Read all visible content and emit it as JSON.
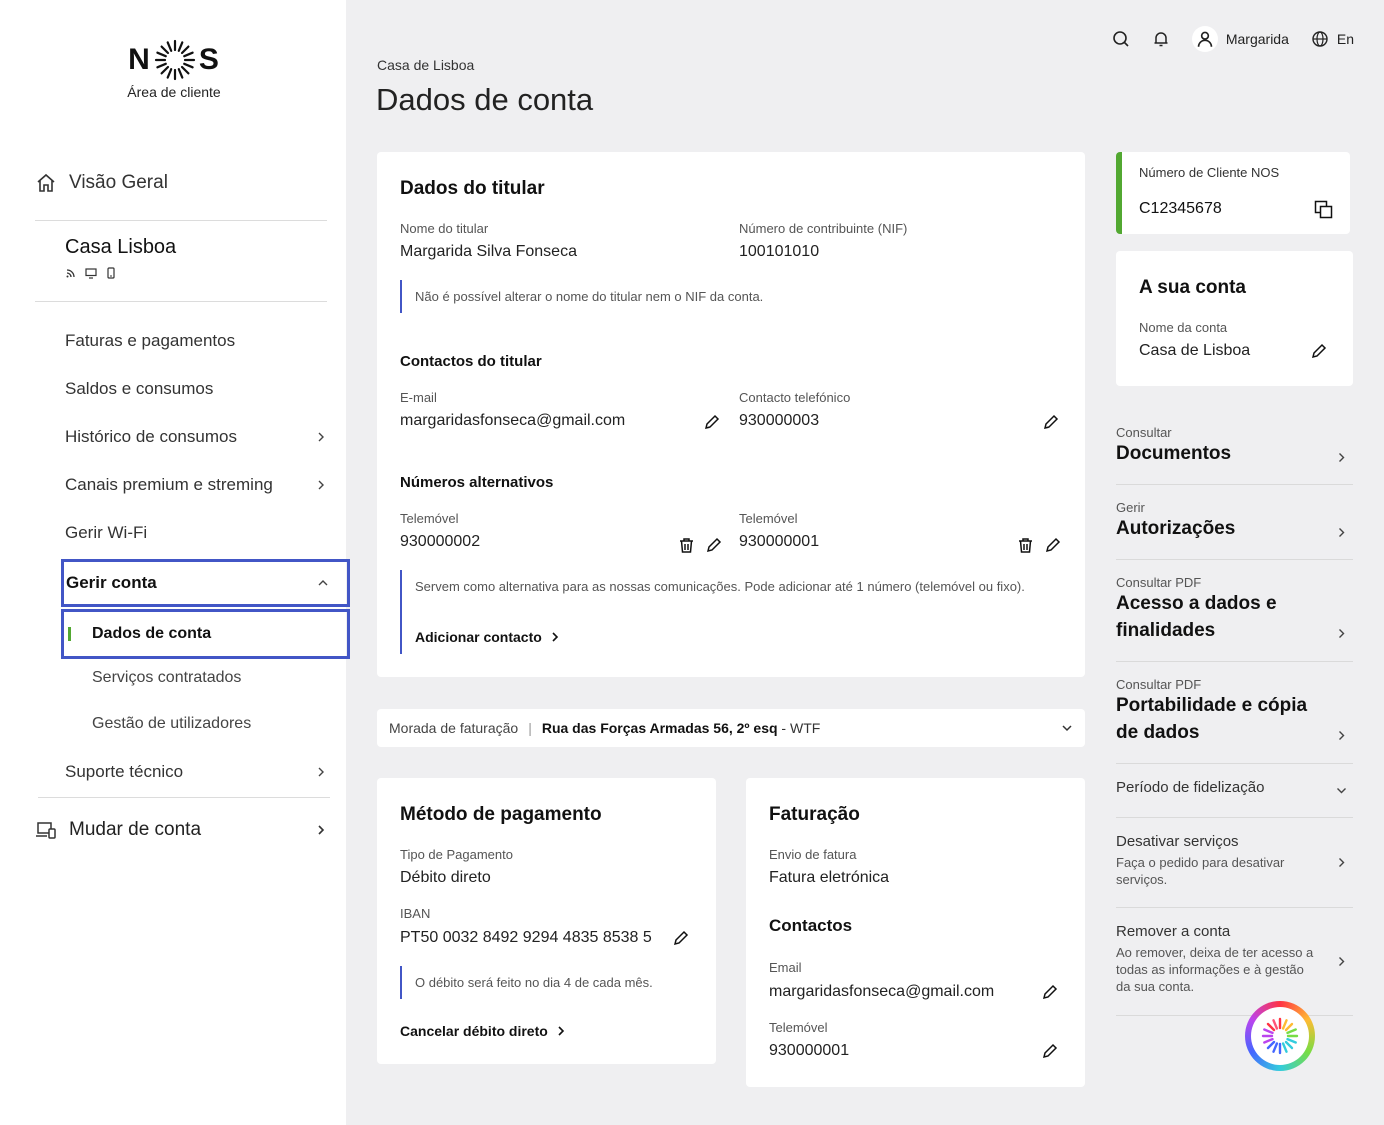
{
  "brand": {
    "logo_left": "N",
    "logo_right": "S",
    "subtitle": "Área de cliente",
    "accent": "#52a831",
    "highlight": "#4256c6"
  },
  "topbar": {
    "user_name": "Margarida",
    "language": "En"
  },
  "sidebar": {
    "overview": "Visão Geral",
    "account_name": "Casa Lisboa",
    "items": [
      {
        "label": "Faturas e pagamentos",
        "chevron": false
      },
      {
        "label": "Saldos e consumos",
        "chevron": false
      },
      {
        "label": "Histórico de consumos",
        "chevron": true
      },
      {
        "label": "Canais premium e streming",
        "chevron": true
      },
      {
        "label": "Gerir Wi-Fi",
        "chevron": false
      }
    ],
    "gerir_conta": "Gerir conta",
    "sub_items": [
      "Dados de conta",
      "Serviços contratados",
      "Gestão de utilizadores"
    ],
    "suporte": "Suporte técnico",
    "mudar_conta": "Mudar de conta"
  },
  "page": {
    "breadcrumb": "Casa de Lisboa",
    "title": "Dados de conta"
  },
  "titular": {
    "title": "Dados do titular",
    "name_label": "Nome do titular",
    "name_value": "Margarida Silva Fonseca",
    "nif_label": "Número de contribuinte (NIF)",
    "nif_value": "100101010",
    "note": "Não é possível alterar o nome do titular nem o NIF da conta.",
    "contacts_title": "Contactos do titular",
    "email_label": "E-mail",
    "email_value": "margaridasfonseca@gmail.com",
    "phone_label": "Contacto telefónico",
    "phone_value": "930000003",
    "alt_title": "Números alternativos",
    "alt1_label": "Telemóvel",
    "alt1_value": "930000002",
    "alt2_label": "Telemóvel",
    "alt2_value": "930000001",
    "alt_note": "Servem como alternativa para as nossas comunicações. Pode adicionar até 1 número (telemóvel ou fixo).",
    "add_contact": "Adicionar contacto"
  },
  "billing_address": {
    "label": "Morada de faturação",
    "divider": "|",
    "street": "Rua das Forças Armadas 56, 2º esq",
    "suffix": " - WTF"
  },
  "payment": {
    "title": "Método de pagamento",
    "type_label": "Tipo de Pagamento",
    "type_value": "Débito direto",
    "iban_label": "IBAN",
    "iban_value": "PT50 0032 8492 9294 4835 8538 5",
    "note": "O débito será feito no dia 4 de cada mês.",
    "cancel": "Cancelar débito direto"
  },
  "invoicing": {
    "title": "Faturação",
    "send_label": "Envio de fatura",
    "send_value": "Fatura eletrónica",
    "contacts_title": "Contactos",
    "email_label": "Email",
    "email_value": "margaridasfonseca@gmail.com",
    "phone_label": "Telemóvel",
    "phone_value": "930000001"
  },
  "client": {
    "label": "Número de Cliente NOS",
    "value": "C12345678"
  },
  "your_account": {
    "title": "A sua conta",
    "name_label": "Nome da conta",
    "name_value": "Casa de Lisboa"
  },
  "right_list": {
    "documents": {
      "small": "Consultar",
      "big": "Documentos"
    },
    "authorizations": {
      "small": "Gerir",
      "big": "Autorizações"
    },
    "data_access": {
      "small": "Consultar PDF",
      "big1": "Acesso a dados e",
      "big2": "finalidades"
    },
    "portability": {
      "small": "Consultar PDF",
      "big1": "Portabilidade e cópia",
      "big2": "de dados"
    },
    "loyalty": {
      "label": "Período de fidelização"
    },
    "deactivate": {
      "label": "Desativar serviços",
      "desc": "Faça o pedido para desativar serviços."
    },
    "remove": {
      "label": "Remover a conta",
      "desc": "Ao remover, deixa de ter acesso a todas as informações e à gestão da sua conta."
    }
  }
}
